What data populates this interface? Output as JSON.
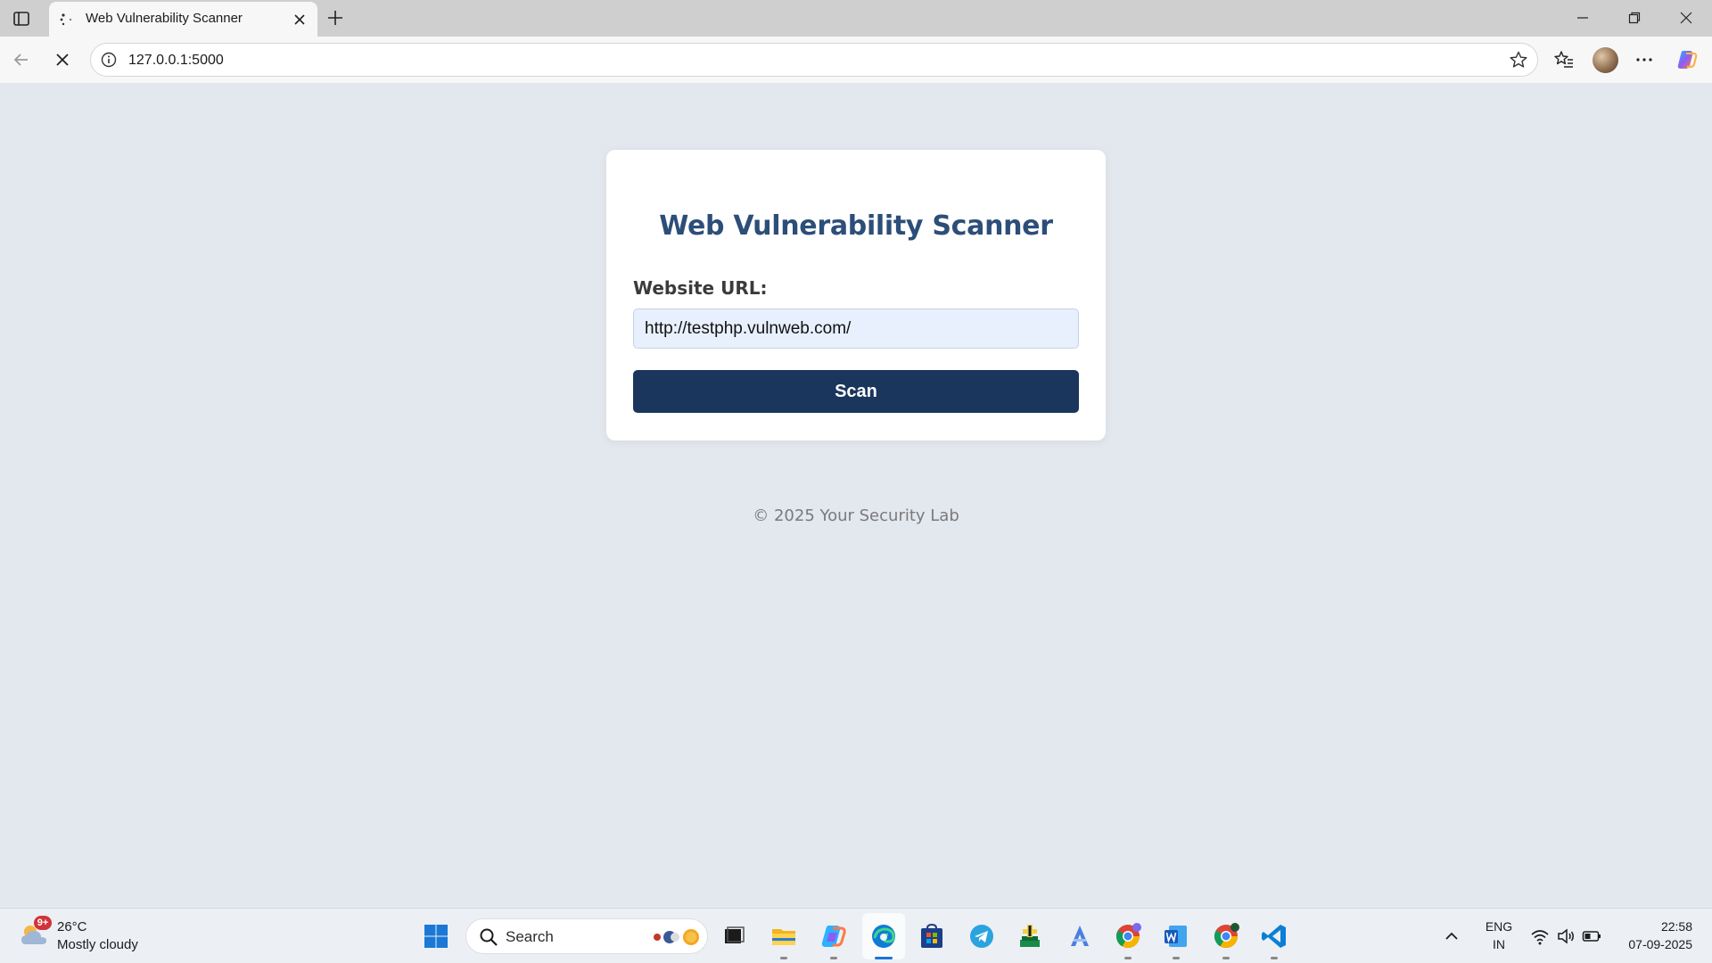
{
  "browser": {
    "tab": {
      "title": "Web Vulnerability Scanner"
    },
    "address": {
      "url": "127.0.0.1:5000"
    }
  },
  "page": {
    "title": "Web Vulnerability Scanner",
    "form": {
      "label": "Website URL:",
      "url_value": "http://testphp.vulnweb.com/",
      "button_label": "Scan"
    },
    "footer": "© 2025 Your Security Lab"
  },
  "taskbar": {
    "weather": {
      "temp": "26°C",
      "desc": "Mostly cloudy",
      "badge": "9+"
    },
    "search_label": "Search",
    "pinned": [
      "task-view",
      "file-explorer",
      "copilot",
      "edge",
      "microsoft-store",
      "telegram",
      "app",
      "app-a",
      "chrome",
      "word",
      "chrome",
      "vs-code"
    ],
    "tray": {
      "lang": "ENG",
      "region": "IN"
    },
    "clock": {
      "time": "22:58",
      "date": "07-09-2025"
    }
  },
  "colors": {
    "page_bg": "#e3e7ee",
    "title": "#2c4e78",
    "button": "#1b365c",
    "input_bg": "#e8f0fe"
  }
}
